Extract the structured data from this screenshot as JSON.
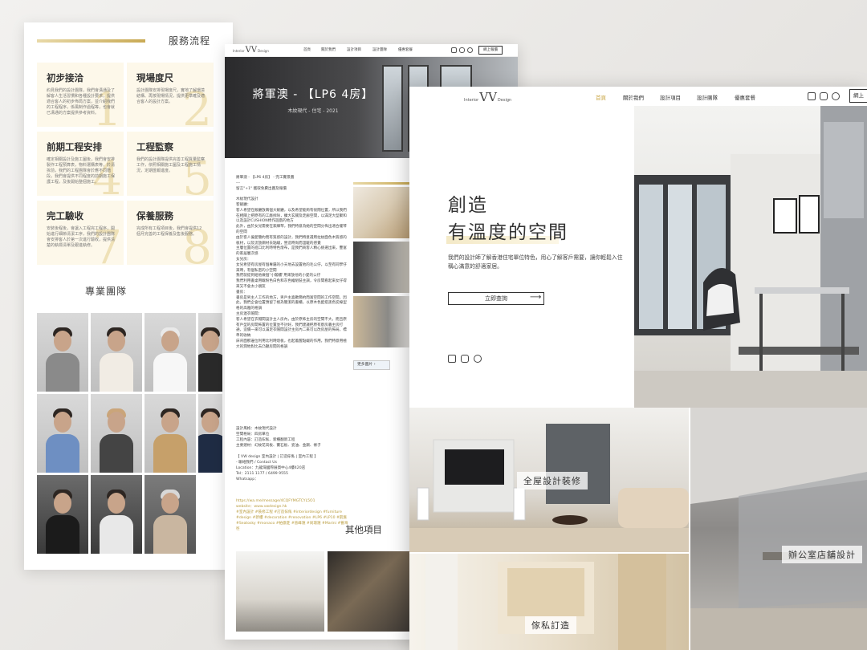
{
  "panel_left": {
    "service_title": "服務流程",
    "steps": [
      {
        "num": "1",
        "title": "初步接洽",
        "desc": "約見我們的設計團隊，我們會溝通及了解客人生活習慣和各種設計要求，提供適合客人的初步佈局方案，並介紹我們的工程程序，係風制作過程等，也會就已溝通的方案提供參考資料。"
      },
      {
        "num": "2",
        "title": "現場度尺",
        "desc": "設計團隊安排現場度尺，實地了解環境結構、再按現場情況，提供更準確及適合客人的設計方案。"
      },
      {
        "num": "4",
        "title": "前期工程安排",
        "desc": "確定相關設計及施工圖後，我們會安排製作工程預算表，物料選購表等，於清拆前，我們的工程團隊會於應不同階段，我們會提供不同程度的前期施工保護工程，及後開始整個施工。"
      },
      {
        "num": "5",
        "title": "工程監察",
        "desc": "我們的設計團隊提供完善工程質量監察工作，依照相關施工圖及工程施工情況，定期匯報進度。"
      },
      {
        "num": "7",
        "title": "完工驗收",
        "desc": "安裝後程後，會讓入工程完工程序，開始進行細節清潔工序，我們的設計團隊會安排客人於第一次進行驗收，提供清楚的執標清單及跟進執修。"
      },
      {
        "num": "8",
        "title": "保養服務",
        "desc": "完成所有工程項目後，我們會提供12個月完善的工程保養及售後服務。"
      }
    ],
    "team_title": "專業團隊"
  },
  "panel_mid": {
    "nav": [
      "首頁",
      "關於我們",
      "設計項目",
      "設計團隊",
      "優惠套餐"
    ],
    "logo_left": "Interior",
    "logo_mark": "VV",
    "logo_right": "Design",
    "shop": "網上報價",
    "hero_title": "將軍澳 - 【LP6 4房】",
    "hero_sub": "木紋現代 - 住宅 - 2021",
    "body": "將軍澳 - 【LP6 4房】 - 完工實景圖\n---\n留言\"+1\" 獲取免費出圖及報價\n\n木紋現代設計\n客飯廳：\n客人希望在飯廳放兩個大飯廳，以及希望能夠有很闊位置，所以我們在相關上把原有的工廠拆除，擴大玄關及走廊空間，以滿足大型聚和以及設計CUSHION椅作遊戲的地方\n此外，由於女兒需要在家練琴，我們特意為她的空間分佈出適合擺琴的空間\n由於客人偏愛簡約而有質感的設計，我們特意選用拉紋面色木質感的板材，以及流放鋼材去點綴，營造時尚而溫暖的感覺\n主層位置的進口比利時特色燈布，是我們商客人精心挑選出來，豐富的家居層次感\n女兒房：\n女兒希望有房屋有個專屬的小天地去設置他的毛公仔，以至有同學仔來時，有個私密的小空間\n我們就提到給他做個\"小閣樓\"用來放他的小愛的公仔\n我們利用書桌用載粉色白色和灰色繪組裝主調，令房間看起來女仔得來又不會太小朋友\n書房：\n書房是男主人工作的地方，男戶主喜歡簡約而富空間的工作空間，因此，我們企會位置預留了極為簡潔的書櫃，以原木色配搭黑色炭線型格的高雅的格調\n主房連衣帽間：\n客人希望在衣帽間設計主人房內，由於原佈主房的空間不大，而且原有戶型的房間佈置的位置並不討好，我們建議把原有廚房牆主房打通，造價一來可以滿足衣帽間設計主房內二來可以改房屋的佈局，標準的收納\n床背面那邊位利用比利時燈板，也起着醒點綴的作用，我們特意用極大的潤地對比去凸顯房間的格調",
    "contact": "設計風格：木紋現代設計\n空間格局：四房單位\n工程內容：訂造傢俬、新櫃翻新工程\n主要建材：幻紋花崗板、實石板、瓷油、金鋼、條子\n\n【 VW design 室內設計 | 訂造傢俬 | 室內工程 】\n- 聯絡我們 / Contact Us\nLocation：九龍灣國際展貿中心4樓420店\nTel：2111 1177 / 6499 9555\nWhatsapp：",
    "tags": "https://wa.me/message/4CQFYMGTCYL5O1\nwebsite：www.vwdesign.hk\n#室內設計 #裝修工程 #訂造傢俬 #interiordesign #furniture #design #新樓 #decoration #renovation #LP6 #LP10 #凱滙 #Seatosky #monaco #柏傲莊 #晉峰滙 #尚璟滙 #Marini #薈海徑",
    "more": "更多圖片",
    "other_title": "其他項目"
  },
  "panel_right": {
    "nav": [
      "首頁",
      "關於我們",
      "設計項目",
      "設計團隊",
      "優惠套餐"
    ],
    "shop": "網上",
    "logo_left": "Interior",
    "logo_mark": "VV",
    "logo_right": "Design",
    "hero_line1": "創造",
    "hero_line2": "有溫度的空間",
    "hero_desc": "我們的設計師了解香港住宅單位特色，用心了解客戶需要，讓你輕鬆入住稱心滿意的舒適家居。",
    "cta": "立即查詢",
    "tiles": [
      {
        "label": "全屋設計裝修"
      },
      {
        "label": "辦公室店舖設計"
      },
      {
        "label": "傢私訂造"
      }
    ]
  },
  "colors": {
    "accent_gold": "#c9a645",
    "step_bg": "#fdf8ea"
  }
}
